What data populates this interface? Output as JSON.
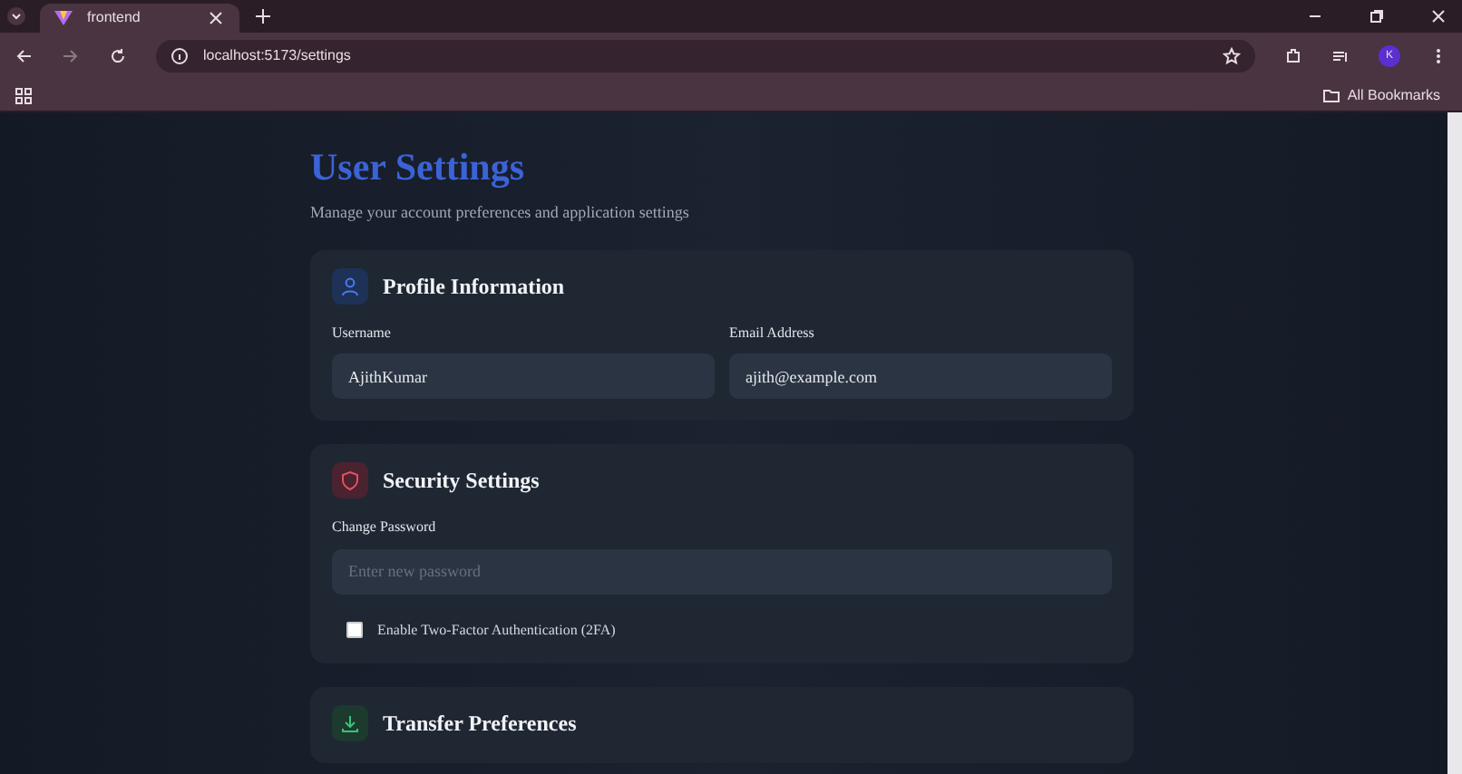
{
  "browser": {
    "tab_title": "frontend",
    "url": "localhost:5173/settings",
    "bookmarks_label": "All Bookmarks",
    "profile_initial": "K"
  },
  "page": {
    "title": "User Settings",
    "subtitle": "Manage your account preferences and application settings",
    "sections": [
      {
        "kind": "profile",
        "title": "Profile Information",
        "fields": [
          {
            "label": "Username",
            "value": "AjithKumar"
          },
          {
            "label": "Email Address",
            "value": "ajith@example.com"
          }
        ]
      },
      {
        "kind": "security",
        "title": "Security Settings",
        "fields": [
          {
            "label": "Change Password",
            "placeholder": "Enter new password"
          }
        ],
        "checkbox": {
          "label": "Enable Two-Factor Authentication (2FA)",
          "checked": false
        }
      },
      {
        "kind": "transfer",
        "title": "Transfer Preferences"
      }
    ]
  }
}
